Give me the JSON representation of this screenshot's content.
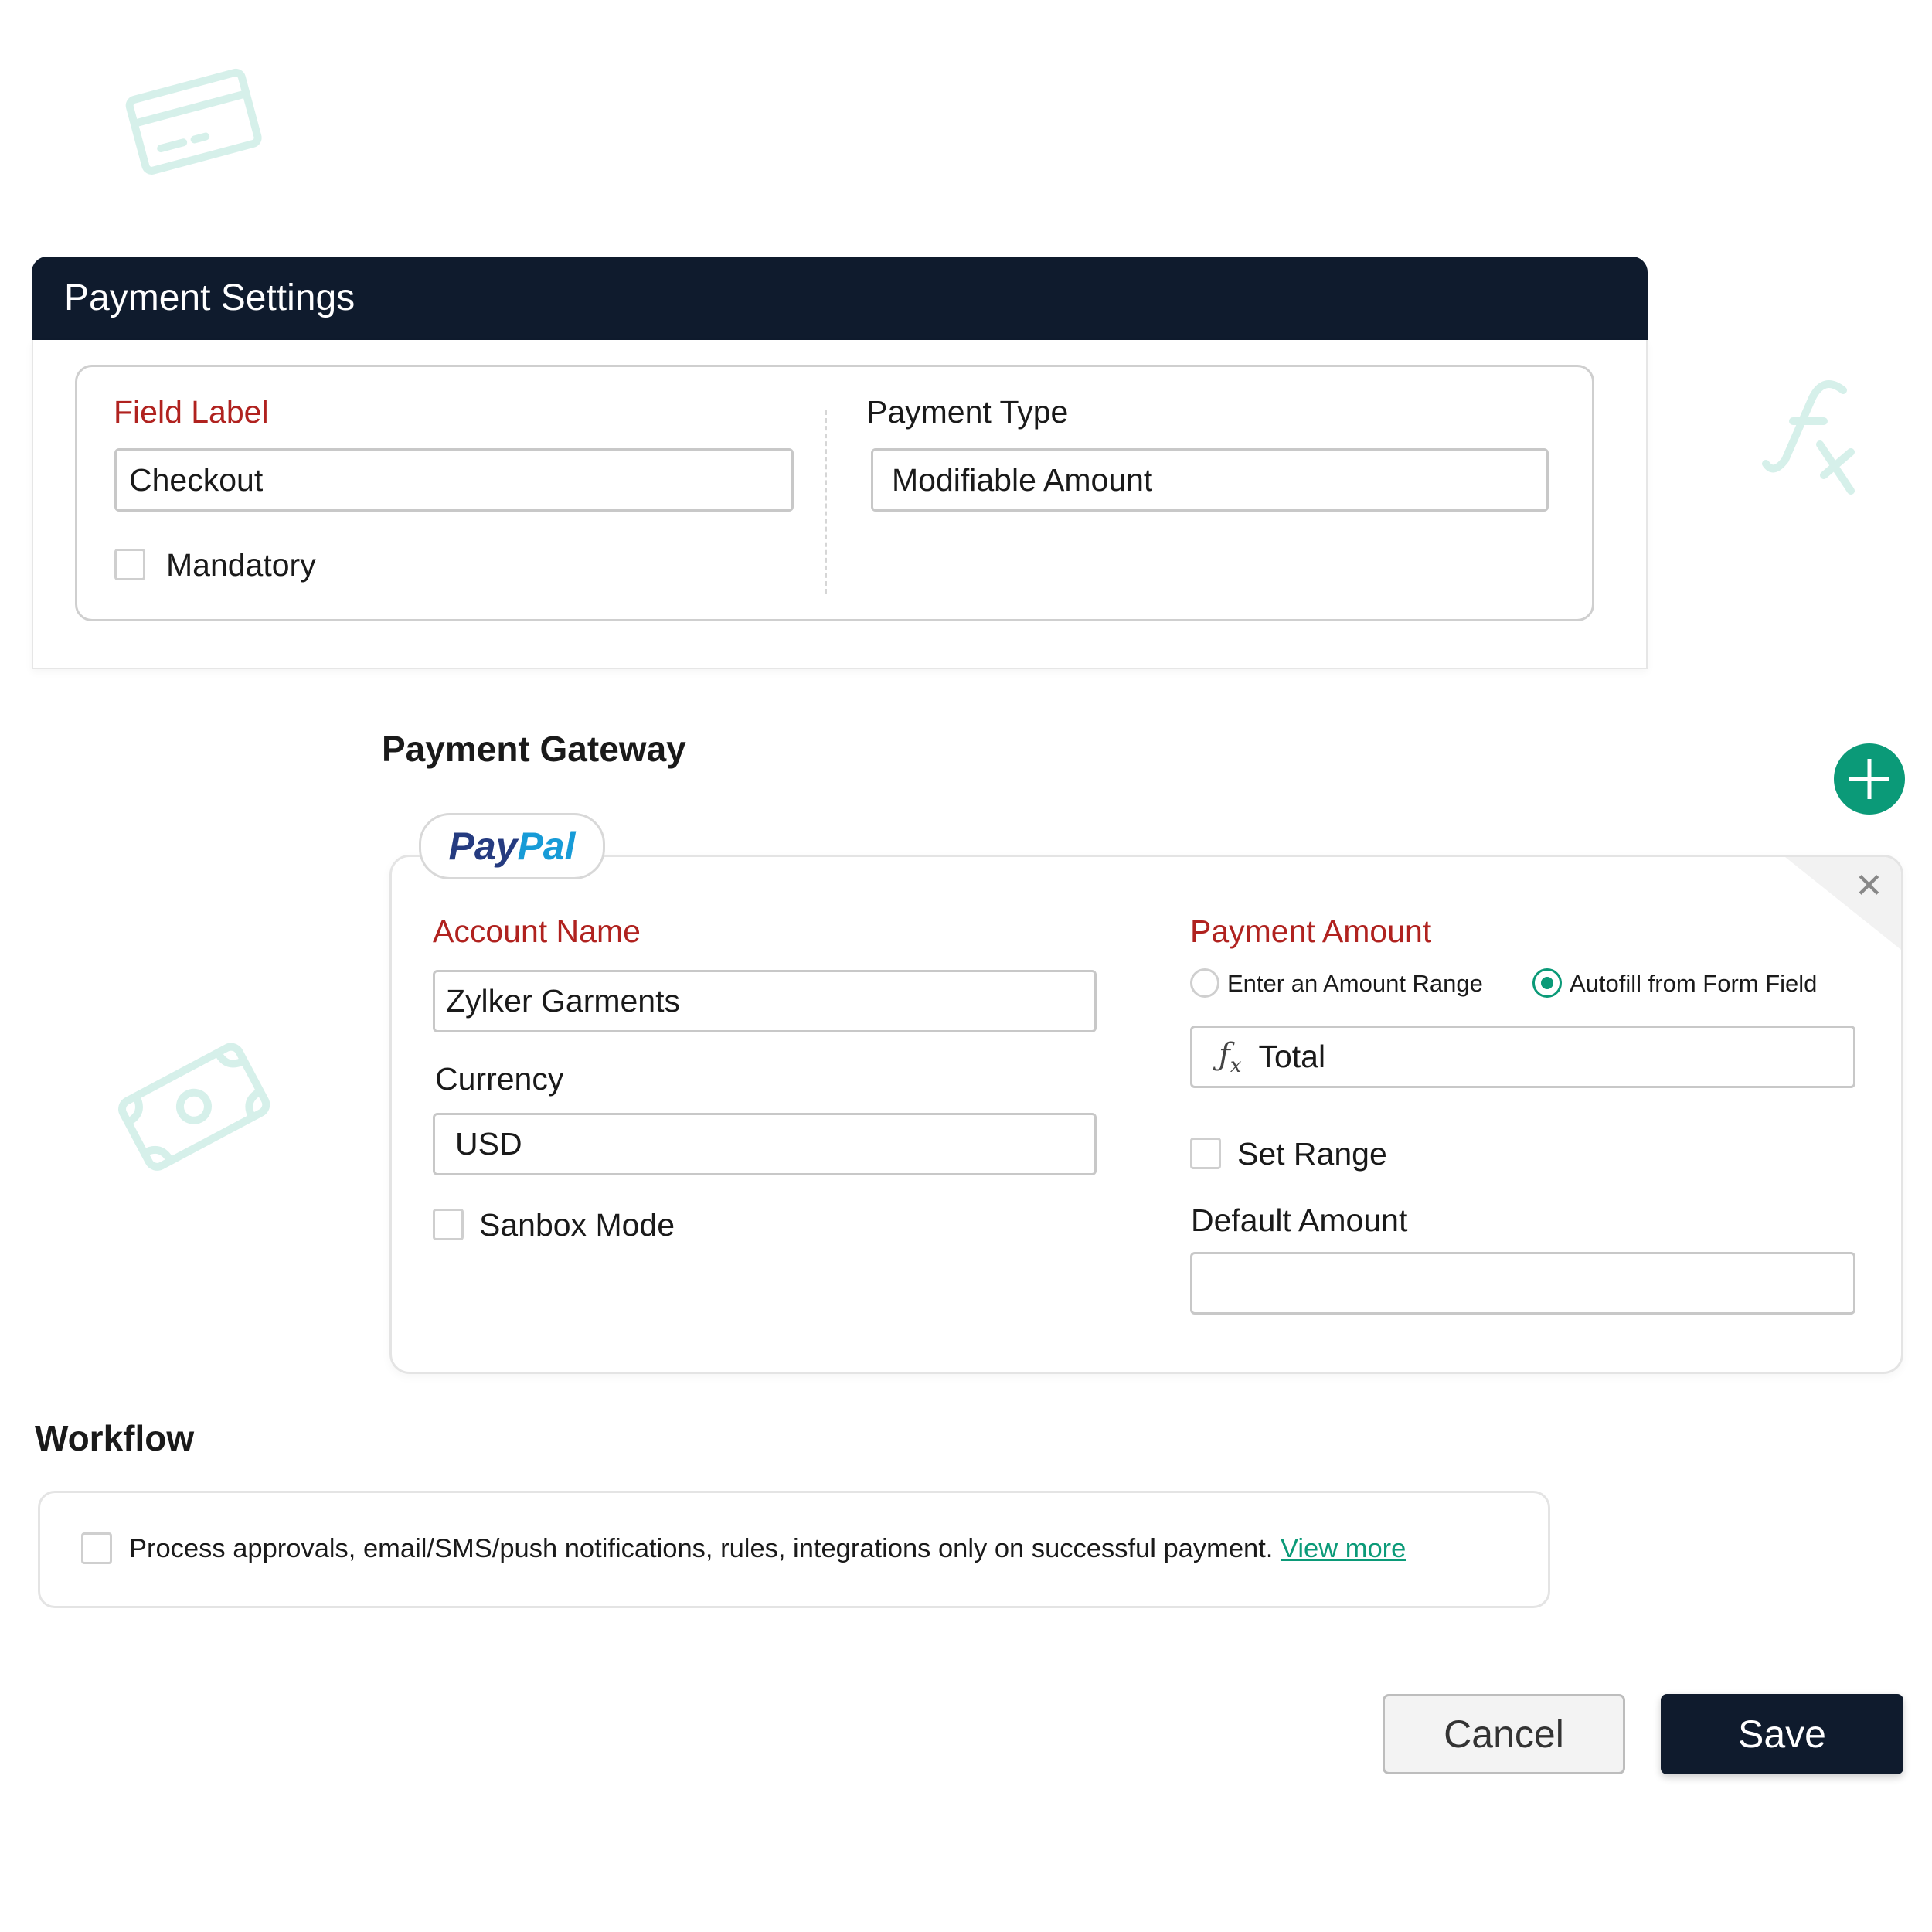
{
  "colors": {
    "header_bg": "#0f1b2d",
    "accent_green": "#0b9a78",
    "required_red": "#b0221f",
    "decor": "#d6f0ea",
    "paypal_dark": "#253b80",
    "paypal_light": "#179bd7"
  },
  "header": {
    "title": "Payment Settings"
  },
  "settings": {
    "field_label": {
      "label": "Field Label",
      "value": "Checkout"
    },
    "mandatory": {
      "label": "Mandatory",
      "checked": false
    },
    "payment_type": {
      "label": "Payment Type",
      "value": "Modifiable Amount"
    }
  },
  "gateway": {
    "heading": "Payment Gateway",
    "add_icon": "plus-icon",
    "tab": {
      "pay": "Pay",
      "pal": "Pal"
    },
    "account_name": {
      "label": "Account Name",
      "value": "Zylker Garments"
    },
    "currency": {
      "label": "Currency",
      "value": "USD"
    },
    "sandbox": {
      "label": "Sanbox Mode",
      "checked": false
    },
    "payment_amount": {
      "label": "Payment Amount",
      "options": [
        {
          "label": "Enter an Amount Range",
          "selected": false
        },
        {
          "label": "Autofill from Form Field",
          "selected": true
        }
      ],
      "formula_icon": "fx-icon",
      "field_value": "Total"
    },
    "set_range": {
      "label": "Set Range",
      "checked": false
    },
    "default_amount": {
      "label": "Default Amount",
      "value": ""
    }
  },
  "workflow": {
    "heading": "Workflow",
    "text": "Process approvals, email/SMS/push notifications, rules, integrations only on successful payment.",
    "link": "View more",
    "checked": false
  },
  "actions": {
    "cancel": "Cancel",
    "save": "Save"
  }
}
